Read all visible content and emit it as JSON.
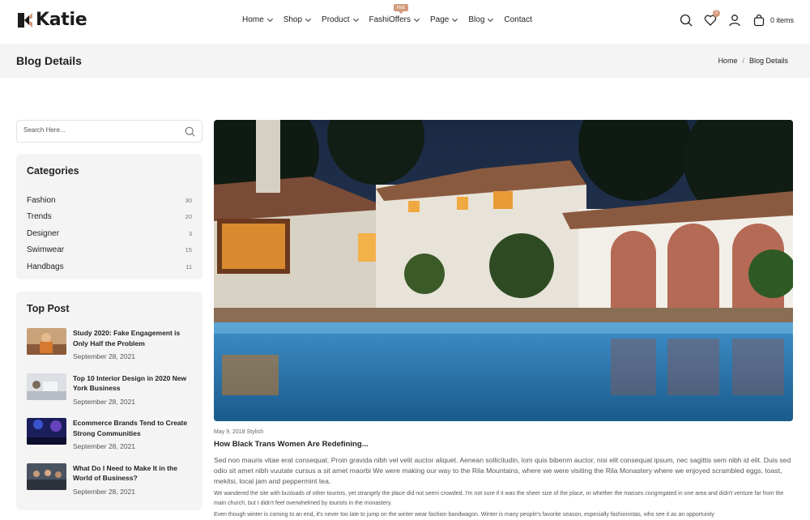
{
  "brand": {
    "name": "Katie",
    "accent": "#d39b7c"
  },
  "nav": {
    "items": [
      {
        "label": "Home"
      },
      {
        "label": "Shop"
      },
      {
        "label": "Product"
      },
      {
        "label": "FashiOffers",
        "badge": "Hot"
      },
      {
        "label": "Page"
      },
      {
        "label": "Blog"
      },
      {
        "label": "Contact"
      }
    ]
  },
  "header": {
    "wishlist_count": "2",
    "cart_label": "0 items",
    "icons": [
      "search-icon",
      "heart-icon",
      "user-icon",
      "shopping-bag-icon"
    ]
  },
  "titlebar": {
    "title": "Blog Details",
    "breadcrumb": [
      "Home",
      "/",
      "Blog Details"
    ]
  },
  "search": {
    "placeholder": "Search Here..."
  },
  "categories": {
    "title": "Categories",
    "items": [
      {
        "name": "Fashion",
        "count": "30"
      },
      {
        "name": "Trends",
        "count": "20"
      },
      {
        "name": "Designer",
        "count": "3"
      },
      {
        "name": "Swimwear",
        "count": "15"
      },
      {
        "name": "Handbags",
        "count": "11"
      }
    ]
  },
  "top_post": {
    "title": "Top Post",
    "items": [
      {
        "title": "Study 2020: Fake Engagement is Only Half the Problem",
        "date": "September 28, 2021"
      },
      {
        "title": "Top 10 Interior Design in 2020 New York Business",
        "date": "September 28, 2021"
      },
      {
        "title": "Ecommerce Brands Tend to Create Strong Communities",
        "date": "September 28, 2021"
      },
      {
        "title": "What Do I Need to Make It in the World of Business?",
        "date": "September 28, 2021"
      }
    ]
  },
  "article": {
    "meta": "May 9, 2018 Stylish",
    "title": "How Black Trans Women Are Redefining...",
    "paragraph1": "Sed non mauris vitae erat consequat. Proin gravida nibh vel velit auctor aliquet. Aenean sollicitudin, lom quis bibenm auctor, nisi elit consequat ipsum, nec sagittis sem nibh id elit. Duis sed odio sit amet nibh vuutate cursus a sit amet maorbi We were making our way to the Rila Mountains, where we were visiting the Rila Monastery where we enjoyed scrambled eggs, toast, mekitsi, local jam and peppermint tea.",
    "paragraph2": "We wandered the site with busloads of other tourists, yet strangely the place did not seem crowded. I'm not sure if it was the sheer size of the place, or whether the masses congregated in one area and didn't venture far from the main church, but I didn't feel overwhelmed by tourists in the monastery.",
    "paragraph3": "Even though winter is coming to an end, it's never too late to jump on the winter wear fashion bandwagon. Winter is many people's favorite season, especially fashionistas, who see it as an opportunity"
  }
}
